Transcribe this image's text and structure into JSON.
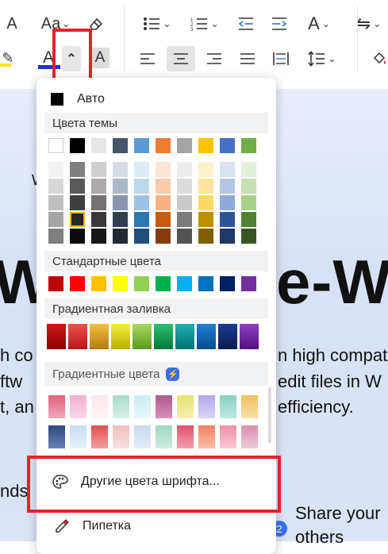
{
  "toolbar": {
    "row1": [
      {
        "name": "font-size-decrease-icon",
        "glyph": "A"
      },
      {
        "name": "change-case-icon",
        "glyph": "Aa"
      },
      {
        "name": "clear-formatting-icon",
        "glyph": "⌫"
      },
      {
        "name": "bullet-list-icon",
        "glyph": "☰"
      },
      {
        "name": "numbered-list-icon",
        "glyph": "☷"
      },
      {
        "name": "decrease-indent-icon",
        "glyph": "⇤"
      },
      {
        "name": "increase-indent-icon",
        "glyph": "⇥"
      },
      {
        "name": "text-direction-icon",
        "glyph": "A"
      },
      {
        "name": "line-direction-icon",
        "glyph": "⇋"
      }
    ],
    "row2": [
      {
        "name": "highlight-icon",
        "glyph": "✎"
      },
      {
        "name": "font-color-icon",
        "glyph": "A"
      },
      {
        "name": "font-color-dropdown-arrow-icon",
        "glyph": "⌃"
      },
      {
        "name": "character-shading-icon",
        "glyph": "A"
      },
      {
        "name": "align-left-icon",
        "glyph": "≡"
      },
      {
        "name": "align-center-icon",
        "glyph": "≡"
      },
      {
        "name": "align-right-icon",
        "glyph": "≡"
      },
      {
        "name": "justify-icon",
        "glyph": "≡"
      },
      {
        "name": "distributed-icon",
        "glyph": "⇹"
      },
      {
        "name": "line-spacing-icon",
        "glyph": "↕"
      },
      {
        "name": "paint-format-icon",
        "glyph": "⌀"
      }
    ],
    "caret": "⌄"
  },
  "document": {
    "letter_w": "W",
    "heading_left": "W",
    "heading_right": "e-W",
    "line1_left": "h co",
    "line1_right": "n high compat",
    "line2_left": "ftw",
    "line2_right": "edit files in W",
    "line3_left": "t, an",
    "line3_right": "efficiency.",
    "line4_left": "nds",
    "share_text": "Share your",
    "others_text": "others",
    "badge": "2"
  },
  "popup": {
    "auto_label": "Авто",
    "theme_colors_title": "Цвета темы",
    "theme_top": [
      "#ffffff",
      "#000000",
      "#e7e6e6",
      "#44546a",
      "#5b9bd5",
      "#ed7d31",
      "#a5a5a5",
      "#ffc000",
      "#4472c4",
      "#70ad47"
    ],
    "theme_shades": [
      [
        "#f2f2f2",
        "#7f7f7f",
        "#d0cece",
        "#d6dce4",
        "#deeaf6",
        "#fbe5d5",
        "#ededed",
        "#fff2cc",
        "#d9e2f3",
        "#e2efd9"
      ],
      [
        "#d8d8d8",
        "#595959",
        "#aeaaaa",
        "#adb9ca",
        "#bdd7ee",
        "#f7cbac",
        "#dbdbdb",
        "#fee599",
        "#b4c6e7",
        "#c5e0b3"
      ],
      [
        "#bfbfbf",
        "#3f3f3f",
        "#757171",
        "#8496b0",
        "#9cc3e5",
        "#f4b183",
        "#c9c9c9",
        "#ffd965",
        "#8eaadb",
        "#a8d08d"
      ],
      [
        "#a5a5a5",
        "#262626",
        "#3a3838",
        "#323f4f",
        "#2e75b5",
        "#c55a11",
        "#7b7b7b",
        "#bf8f00",
        "#2f5496",
        "#538135"
      ],
      [
        "#7f7f7f",
        "#0c0c0c",
        "#171616",
        "#222a35",
        "#1e4e79",
        "#833c0b",
        "#525252",
        "#7f6000",
        "#1f3864",
        "#375623"
      ]
    ],
    "standard_colors_title": "Стандартные цвета",
    "standard_colors": [
      "#c00000",
      "#ff0000",
      "#ffc000",
      "#ffff00",
      "#92d050",
      "#00b050",
      "#00b0f0",
      "#0070c0",
      "#002060",
      "#7030a0"
    ],
    "gradient_fill_title": "Градиентная заливка",
    "gradient_fill": [
      [
        "#d01818",
        "#8a0000"
      ],
      [
        "#f05050",
        "#b81818"
      ],
      [
        "#f2c040",
        "#b87a10"
      ],
      [
        "#f4ee40",
        "#b8b000"
      ],
      [
        "#a8d860",
        "#5c9a1c"
      ],
      [
        "#30c070",
        "#007a38"
      ],
      [
        "#20b0b0",
        "#007070"
      ],
      [
        "#2080d0",
        "#0a4c90"
      ],
      [
        "#1a3c90",
        "#0a1c50"
      ],
      [
        "#9040c0",
        "#501080"
      ]
    ],
    "gradient_colors_title": "Градиентные цвета",
    "gradient_colors_row1": [
      [
        "#e06080",
        "#f0a8b8"
      ],
      [
        "#f0b0d0",
        "#f8d8e8"
      ],
      [
        "#fbe8ec",
        "#fff4f6"
      ],
      [
        "#a8dcc8",
        "#d8f0e8"
      ],
      [
        "#c8ecf0",
        "#e8f8fa"
      ],
      [
        "#b05890",
        "#d890b8"
      ],
      [
        "#e8e070",
        "#f4f0b0"
      ],
      [
        "#b0a8e8",
        "#d8d4f4"
      ],
      [
        "#88d0c0",
        "#c0e8e0"
      ],
      [
        "#f0c060",
        "#f8e0a8"
      ]
    ],
    "gradient_colors_row2": [
      [
        "#304880",
        "#6880b8"
      ],
      [
        "#c8dcf4",
        "#e8f0fa"
      ],
      [
        "#e05050",
        "#f0a0a0"
      ],
      [
        "#f0c0c0",
        "#f8e0e0"
      ],
      [
        "#c8d8f0",
        "#e4ecf8"
      ],
      [
        "#a0d8c0",
        "#d0ece0"
      ],
      [
        "#e05070",
        "#f0a0b0"
      ],
      [
        "#f08060",
        "#f8c0a8"
      ],
      [
        "#f090a8",
        "#f8c8d4"
      ],
      [
        "#d890b0",
        "#ecc8d8"
      ]
    ],
    "more_colors_label": "Другие цвета шрифта...",
    "eyedropper_label": "Пипетка"
  },
  "accent": {
    "highlight_red": "#e8202a",
    "font_color_bar": "#1f2fd6",
    "highlight_bar": "#f6e800",
    "premium_badge": "#3a6ff0"
  }
}
